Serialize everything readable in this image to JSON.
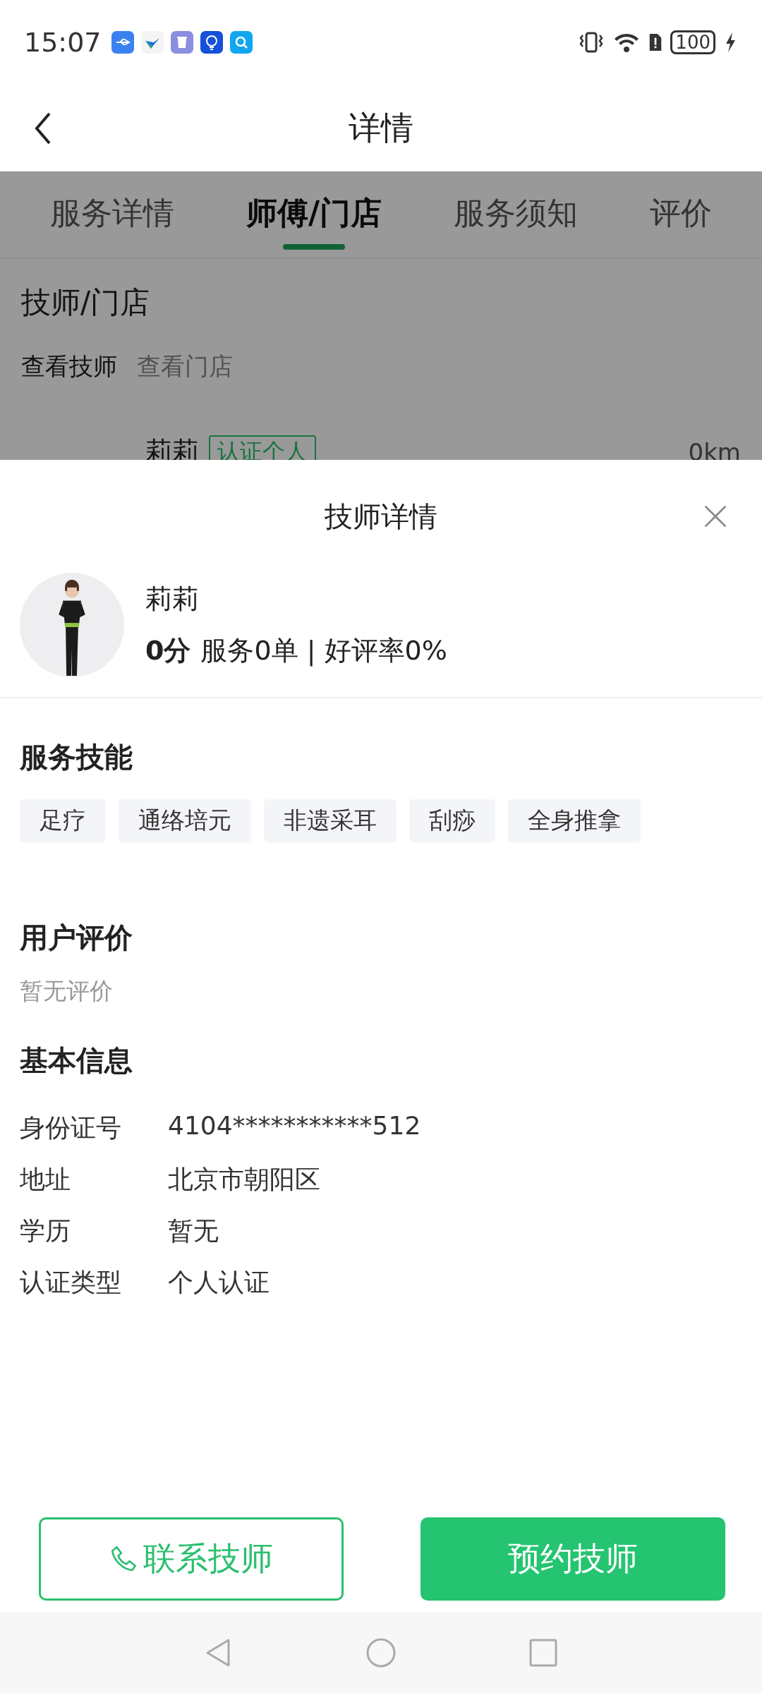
{
  "status_bar": {
    "time": "15:07",
    "battery": "100"
  },
  "header": {
    "title": "详情"
  },
  "tabs": [
    {
      "label": "服务详情",
      "selected": false
    },
    {
      "label": "师傅/门店",
      "selected": true
    },
    {
      "label": "服务须知",
      "selected": false
    },
    {
      "label": "评价",
      "selected": false
    }
  ],
  "section_title": "技师/门店",
  "sub_tabs": [
    {
      "label": "查看技师",
      "selected": true
    },
    {
      "label": "查看门店",
      "selected": false
    }
  ],
  "technician_row": {
    "name": "莉莉",
    "badge": "认证个人",
    "distance": "0km"
  },
  "sheet": {
    "title": "技师详情",
    "profile": {
      "name": "莉莉",
      "score": "0分",
      "stats": "服务0单 | 好评率0%"
    },
    "skills_title": "服务技能",
    "skills": [
      "足疗",
      "通络培元",
      "非遗采耳",
      "刮痧",
      "全身推拿"
    ],
    "reviews_title": "用户评价",
    "reviews_empty": "暂无评价",
    "info_title": "基本信息",
    "info": [
      {
        "label": "身份证号",
        "value": "4104***********512"
      },
      {
        "label": "地址",
        "value": "北京市朝阳区"
      },
      {
        "label": "学历",
        "value": "暂无"
      },
      {
        "label": "认证类型",
        "value": "个人认证"
      }
    ]
  },
  "buttons": [
    {
      "kind": "outline",
      "label": "联系技师"
    },
    {
      "kind": "filled",
      "label": "预约技师"
    }
  ]
}
